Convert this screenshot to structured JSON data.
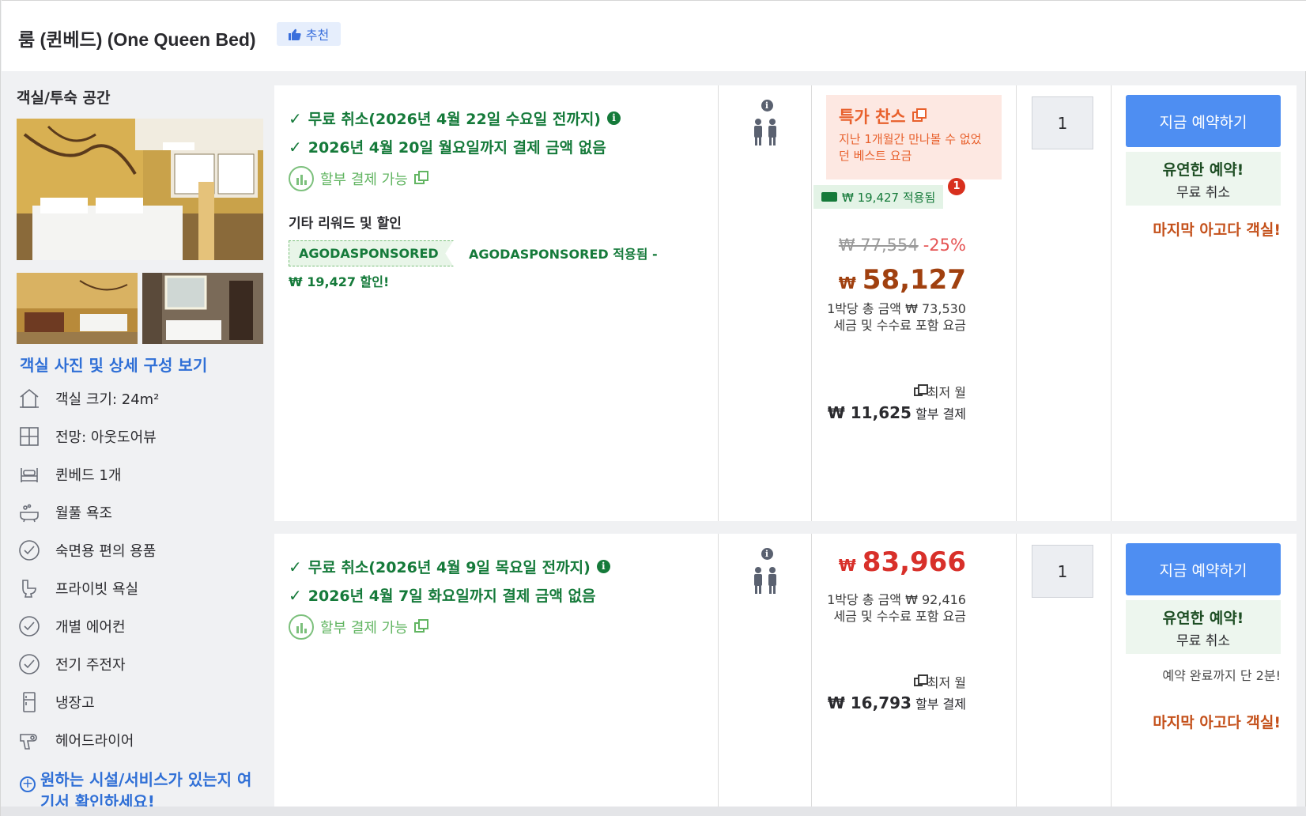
{
  "header": {
    "room_title": "룸 (퀸베드) (One Queen Bed)",
    "recommend_label": "추천"
  },
  "left": {
    "space_label": "객실/투숙 공간",
    "photo_link": "객실 사진 및 상세 구성 보기",
    "features": [
      {
        "icon": "house-icon",
        "label": "객실 크기: 24m²"
      },
      {
        "icon": "window-icon",
        "label": "전망: 아웃도어뷰"
      },
      {
        "icon": "bed-icon",
        "label": "퀸베드 1개"
      },
      {
        "icon": "bathtub-icon",
        "label": "월풀 욕조"
      },
      {
        "icon": "check-circle-icon",
        "label": "숙면용 편의 용품"
      },
      {
        "icon": "toilet-icon",
        "label": "프라이빗 욕실"
      },
      {
        "icon": "check-circle-icon",
        "label": "개별 에어컨"
      },
      {
        "icon": "check-circle-icon",
        "label": "전기 주전자"
      },
      {
        "icon": "fridge-icon",
        "label": "냉장고"
      },
      {
        "icon": "hairdryer-icon",
        "label": "헤어드라이어"
      }
    ],
    "facility_link": "원하는 시설/서비스가 있는지 여기서 확인하세요!"
  },
  "offers": [
    {
      "cancel": "무료 취소(2026년 4월 22일 수요일 전까지)",
      "no_payment": "2026년 4월 20일 월요일까지 결제 금액 없음",
      "installment": "할부 결제 가능",
      "rewards_title": "기타 리워드 및 할인",
      "coupon_code": "AGODASPONSORED",
      "coupon_text": "AGODASPONSORED 적용됨 - ₩ 19,427 할인!",
      "deal_title": "특가 찬스",
      "deal_desc": "지난 1개월간 만나볼 수 없었던 베스트 요금",
      "applied": "₩ 19,427 적용됨",
      "applied_count": "1",
      "old_price": "₩ 77,554",
      "discount": "-25%",
      "currency": "₩",
      "price": "58,127",
      "per_night": "1박당 총 금액 ₩ 73,530",
      "tax_note": "세금 및 수수료 포함 요금",
      "lowest": "최저 월",
      "monthly_amount": "₩ 11,625",
      "monthly_label": "할부 결제",
      "qty": "1",
      "book": "지금 예약하기",
      "flex_title": "유연한 예약!",
      "flex_sub": "무료 취소",
      "last_room": "마지막 아고다 객실!",
      "price_color": "#a0400f"
    },
    {
      "cancel": "무료 취소(2026년 4월 9일 목요일 전까지)",
      "no_payment": "2026년 4월 7일 화요일까지 결제 금액 없음",
      "installment": "할부 결제 가능",
      "currency": "₩",
      "price": "83,966",
      "per_night": "1박당 총 금액 ₩ 92,416",
      "tax_note": "세금 및 수수료 포함 요금",
      "lowest": "최저 월",
      "monthly_amount": "₩ 16,793",
      "monthly_label": "할부 결제",
      "qty": "1",
      "book": "지금 예약하기",
      "flex_title": "유연한 예약!",
      "flex_sub": "무료 취소",
      "only_two": "예약 완료까지 단 2분!",
      "last_room": "마지막 아고다 객실!",
      "price_color": "#d8302a"
    }
  ]
}
